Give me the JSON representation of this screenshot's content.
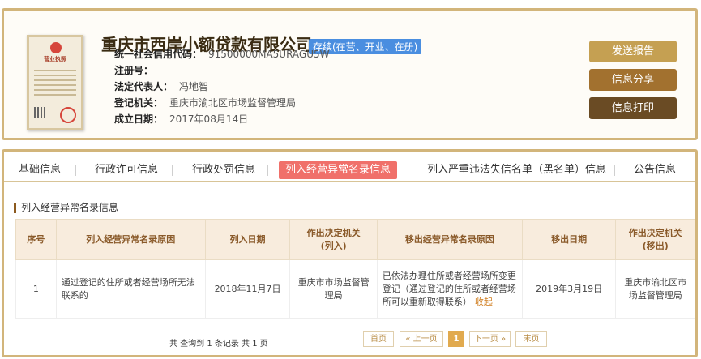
{
  "company": {
    "name": "重庆市西岸小额贷款有限公司",
    "status": "存续(在营、开业、在册)",
    "license_label": "营业执照",
    "fields": [
      {
        "label": "统一社会信用代码：",
        "value": "91500000MA5URAGU5W"
      },
      {
        "label": "注册号：",
        "value": ""
      },
      {
        "label": "法定代表人：",
        "value": "冯地智"
      },
      {
        "label": "登记机关：",
        "value": "重庆市渝北区市场监督管理局"
      },
      {
        "label": "成立日期：",
        "value": "2017年08月14日"
      }
    ]
  },
  "actions": {
    "report": "发送报告",
    "share": "信息分享",
    "print": "信息打印"
  },
  "tabs": [
    "基础信息",
    "行政许可信息",
    "行政处罚信息",
    "列入经营异常名录信息",
    "列入严重违法失信名单（黑名单）信息",
    "公告信息"
  ],
  "active_tab": "列入经营异常名录信息",
  "section_title": "列入经营异常名录信息",
  "table": {
    "headers": [
      "序号",
      "列入经营异常名录原因",
      "列入日期",
      "作出决定机关\n(列入)",
      "移出经营异常名录原因",
      "移出日期",
      "作出决定机关\n(移出)"
    ],
    "rows": [
      {
        "no": "1",
        "reason_in": "通过登记的住所或者经营场所无法联系的",
        "date_in": "2018年11月7日",
        "org_in": "重庆市市场监督管理局",
        "reason_out": "已依法办理住所或者经营场所变更登记（通过登记的住所或者经营场所可以重新取得联系）",
        "collapse": "收起",
        "date_out": "2019年3月19日",
        "org_out": "重庆市渝北区市场监督管理局"
      }
    ]
  },
  "pagination": {
    "summary": "共 查询到 1 条记录 共 1 页",
    "first": "首页",
    "prev": "« 上一页",
    "current": "1",
    "next": "下一页 »",
    "last": "末页"
  }
}
